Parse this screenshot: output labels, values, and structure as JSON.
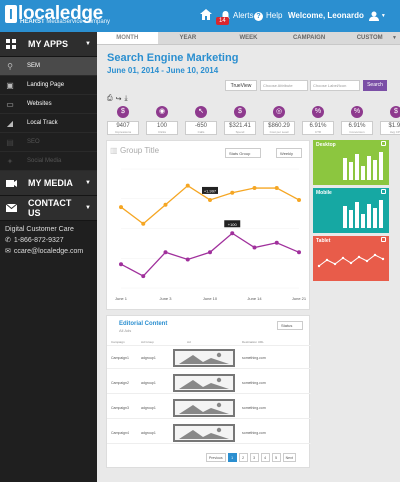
{
  "app": {
    "brand": "localedge",
    "brand_mark": "l",
    "sub_brand": "HEARST",
    "sub_brand_rest": " MediaService Company",
    "alerts_label": "Alerts",
    "alerts_count": "14",
    "help_label": "Help",
    "welcome": "Welcome, Leonardo"
  },
  "sidebar": {
    "my_apps": "MY APPS",
    "items": [
      {
        "label": "SEM",
        "icon": "search-icon"
      },
      {
        "label": "Landing Page",
        "icon": "page-icon"
      },
      {
        "label": "Websites",
        "icon": "monitor-icon"
      },
      {
        "label": "Local Track",
        "icon": "track-icon"
      },
      {
        "label": "SEO",
        "icon": "seo-icon"
      },
      {
        "label": "Social Media",
        "icon": "social-icon"
      }
    ],
    "my_media": "MY MEDIA",
    "contact_us": "CONTACT US",
    "care_title": "Digital Customer Care",
    "phone": "1-866-872-9327",
    "email": "ccare@localedge.com"
  },
  "tabs": [
    {
      "label": "MONTH"
    },
    {
      "label": "YEAR"
    },
    {
      "label": "WEEK"
    },
    {
      "label": "CAMPAIGN"
    },
    {
      "label": "CUSTOM"
    }
  ],
  "page": {
    "title": "Search Engine Marketing",
    "date_range": "June 01, 2014 - June 10, 2014"
  },
  "filters": {
    "trueview": "TrueView",
    "select1": "Choose Attribute",
    "select2": "Choose Label/Icon",
    "search": "Search"
  },
  "metrics": [
    {
      "icon": "$",
      "value": "9407",
      "label": "Impressions"
    },
    {
      "icon": "◉",
      "value": "100",
      "label": "Clicks"
    },
    {
      "icon": "↖",
      "value": "-650",
      "label": "Calls"
    },
    {
      "icon": "$",
      "value": "$321.41",
      "label": "Spend"
    },
    {
      "icon": "◎",
      "value": "$860.29",
      "label": "Cost per Lead"
    },
    {
      "icon": "%",
      "value": "6.91%",
      "label": "CTR"
    },
    {
      "icon": "%",
      "value": "6.91%",
      "label": "Conversion"
    },
    {
      "icon": "$",
      "value": "$1.94",
      "label": "Avg CPC"
    }
  ],
  "chart_panel": {
    "title": "Group Title",
    "stats_group": "Stats Group",
    "weekly": "Weekly"
  },
  "colors": {
    "brand_blue": "#2b8fd0",
    "orange": "#f5a623",
    "purple": "#a0309c",
    "desktop": "#8cc63f",
    "mobile": "#16a8a3",
    "tablet": "#e85c4a"
  },
  "chart_data": {
    "type": "line",
    "x": [
      "June 1",
      "June 3",
      "June 10",
      "June 14",
      "June 21"
    ],
    "series": [
      {
        "values": [
          34,
          27,
          35,
          43,
          37,
          40,
          42,
          42,
          37
        ]
      },
      {
        "values": [
          10,
          5,
          15,
          12,
          15,
          23,
          17,
          19,
          15
        ]
      }
    ],
    "annotations": [
      "+1,997",
      "+100"
    ],
    "ylim": [
      0,
      50
    ]
  },
  "devices": [
    {
      "label": "Desktop"
    },
    {
      "label": "Mobile"
    },
    {
      "label": "Tablet"
    }
  ],
  "editorial": {
    "title": "Editorial Content",
    "subtitle": "All Ads",
    "status": "Status",
    "headers": [
      "Campaign",
      "Ad Group",
      "Ad",
      "Destination URL"
    ],
    "rows": [
      {
        "campaign": "Campaign1",
        "group": "adgroup1",
        "url": "something.com"
      },
      {
        "campaign": "Campaign2",
        "group": "adgroup1",
        "url": "something.com"
      },
      {
        "campaign": "Campaign3",
        "group": "adgroup1",
        "url": "something.com"
      },
      {
        "campaign": "Campaign4",
        "group": "adgroup1",
        "url": "something.com"
      }
    ]
  },
  "pagination": {
    "previous": "Previous",
    "pages": [
      "1",
      "2",
      "3",
      "4",
      "5"
    ],
    "next": "Next",
    "current": "1"
  }
}
